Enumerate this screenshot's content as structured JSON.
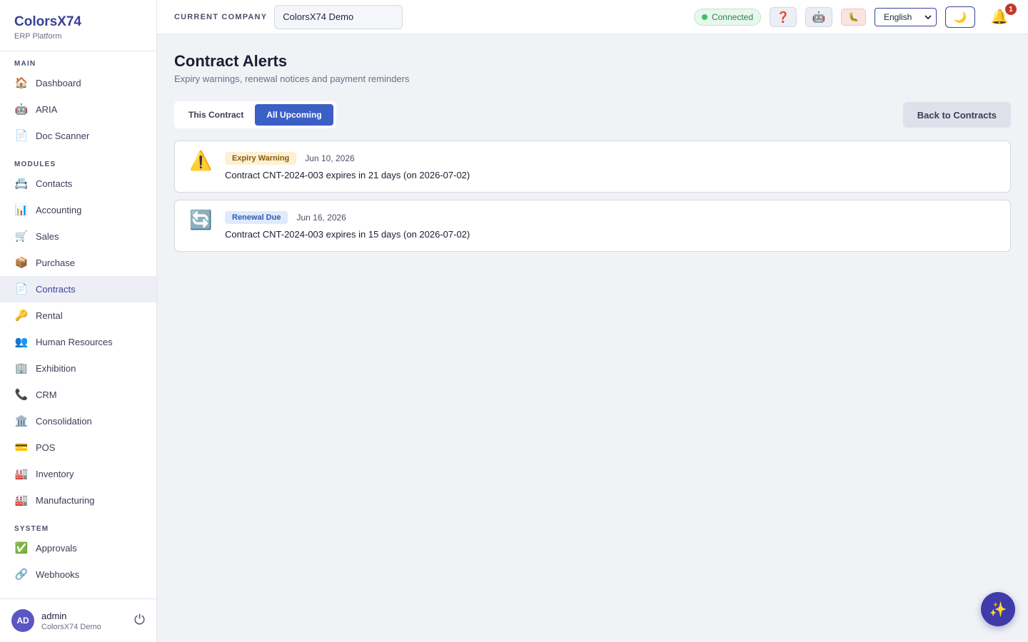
{
  "brand": {
    "name": "ColorsX74",
    "subtitle": "ERP Platform"
  },
  "sidebar": {
    "sections": [
      {
        "title": "MAIN",
        "items": [
          {
            "label": "Dashboard",
            "icon": "🏠",
            "icon_name": "home-icon"
          },
          {
            "label": "ARIA",
            "icon": "🤖",
            "icon_name": "robot-icon"
          },
          {
            "label": "Doc Scanner",
            "icon": "📄",
            "icon_name": "document-icon"
          }
        ]
      },
      {
        "title": "MODULES",
        "items": [
          {
            "label": "Contacts",
            "icon": "📇",
            "icon_name": "contact-card-icon"
          },
          {
            "label": "Accounting",
            "icon": "📊",
            "icon_name": "bar-chart-icon"
          },
          {
            "label": "Sales",
            "icon": "🛒",
            "icon_name": "cart-icon"
          },
          {
            "label": "Purchase",
            "icon": "📦",
            "icon_name": "package-icon"
          },
          {
            "label": "Contracts",
            "icon": "📄",
            "icon_name": "document-icon",
            "active": true
          },
          {
            "label": "Rental",
            "icon": "🔑",
            "icon_name": "key-icon"
          },
          {
            "label": "Human Resources",
            "icon": "👥",
            "icon_name": "people-icon"
          },
          {
            "label": "Exhibition",
            "icon": "🏢",
            "icon_name": "building-icon"
          },
          {
            "label": "CRM",
            "icon": "📞",
            "icon_name": "phone-icon"
          },
          {
            "label": "Consolidation",
            "icon": "🏛️",
            "icon_name": "bank-icon"
          },
          {
            "label": "POS",
            "icon": "💳",
            "icon_name": "credit-card-icon"
          },
          {
            "label": "Inventory",
            "icon": "🏭",
            "icon_name": "factory-icon"
          },
          {
            "label": "Manufacturing",
            "icon": "🏭",
            "icon_name": "factory-icon"
          }
        ]
      },
      {
        "title": "SYSTEM",
        "items": [
          {
            "label": "Approvals",
            "icon": "✅",
            "icon_name": "check-icon"
          },
          {
            "label": "Webhooks",
            "icon": "🔗",
            "icon_name": "link-icon"
          }
        ]
      }
    ]
  },
  "user": {
    "initials": "AD",
    "name": "admin",
    "company": "ColorsX74 Demo"
  },
  "topbar": {
    "company_label": "CURRENT COMPANY",
    "company_value": "ColorsX74 Demo",
    "status": "Connected",
    "language": "English",
    "notification_count": "1",
    "status_color": "#3fbf6a"
  },
  "page": {
    "title": "Contract Alerts",
    "subtitle": "Expiry warnings, renewal notices and payment reminders",
    "tabs": [
      "This Contract",
      "All Upcoming"
    ],
    "active_tab": 1,
    "back_button": "Back to Contracts"
  },
  "alerts": [
    {
      "type": "Expiry Warning",
      "variant": "warning",
      "icon": "⚠️",
      "icon_name": "warning-icon",
      "date": "Jun 10, 2026",
      "message": "Contract CNT-2024-003 expires in 21 days (on 2026-07-02)"
    },
    {
      "type": "Renewal Due",
      "variant": "renewal",
      "icon": "🔄",
      "icon_name": "refresh-icon",
      "date": "Jun 16, 2026",
      "message": "Contract CNT-2024-003 expires in 15 days (on 2026-07-02)"
    }
  ],
  "accent_color": "#3a5fc5"
}
